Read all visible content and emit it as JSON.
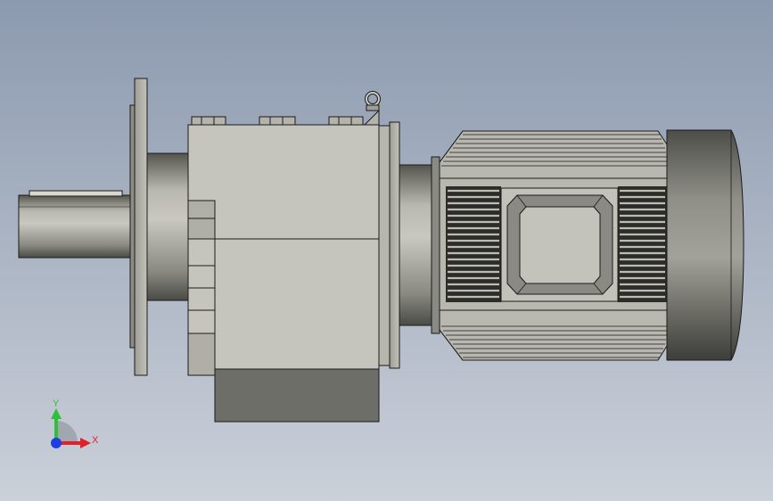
{
  "viewport": {
    "background_top": "#8c9aaf",
    "background_bottom": "#c9ced8"
  },
  "model": {
    "housing_color": "#c4c3bb",
    "shadow_color": "#6f6f69",
    "cap_color": "#8e8e88",
    "outline_color": "#1a1a1a"
  },
  "triad": {
    "x_label": "X",
    "y_label": "Y",
    "x_color": "#e0202a",
    "y_color": "#2fbf3a",
    "z_color": "#1e3fe0"
  }
}
